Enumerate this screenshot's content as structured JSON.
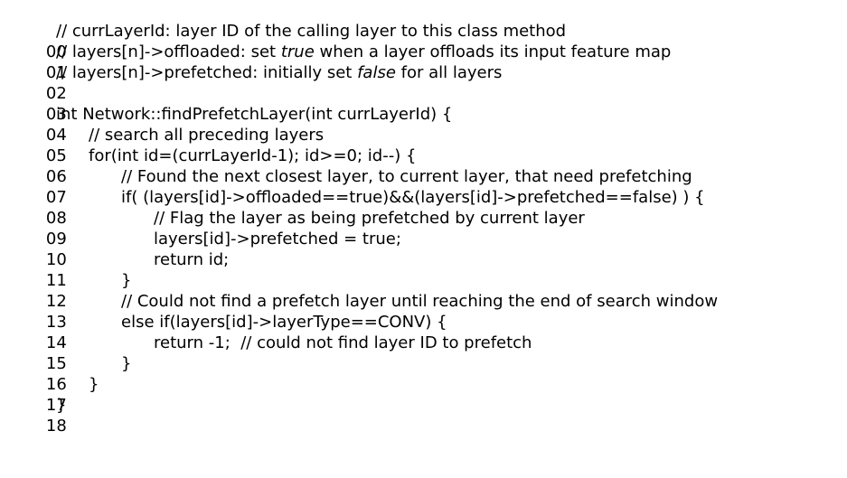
{
  "lines": [
    {
      "num": "00",
      "parts": [
        "// currLayerId: layer ID of the calling layer to this class method"
      ]
    },
    {
      "num": "01",
      "parts": [
        "// layers[n]->offloaded: set ",
        "true",
        " when a layer offloads its input feature map"
      ]
    },
    {
      "num": "02",
      "parts": [
        "// layers[n]->prefetched: initially set ",
        "false",
        " for all layers"
      ]
    },
    {
      "num": "03",
      "parts": [
        ""
      ]
    },
    {
      "num": "04",
      "parts": [
        "int Network::findPrefetchLayer(int currLayerId) {"
      ]
    },
    {
      "num": "05",
      "parts": [
        "// search all preceding layers"
      ]
    },
    {
      "num": "06",
      "parts": [
        "for(int id=(currLayerId-1); id>=0; id--) {"
      ]
    },
    {
      "num": "07",
      "parts": [
        "// Found the next closest layer, to current layer, that need prefetching"
      ]
    },
    {
      "num": "08",
      "parts": [
        "if( (layers[id]->offloaded==true)&&(layers[id]->prefetched==false) ) {"
      ]
    },
    {
      "num": "09",
      "parts": [
        "// Flag the layer as being prefetched by current layer"
      ]
    },
    {
      "num": "10",
      "parts": [
        "layers[id]->prefetched = true;"
      ]
    },
    {
      "num": "11",
      "parts": [
        "return id;"
      ]
    },
    {
      "num": "12",
      "parts": [
        "}"
      ]
    },
    {
      "num": "13",
      "parts": [
        "// Could not find a prefetch layer until reaching the end of search window"
      ]
    },
    {
      "num": "14",
      "parts": [
        "else if(layers[id]->layerType==CONV) {"
      ]
    },
    {
      "num": "15",
      "parts": [
        "return -1;  // could not find layer ID to prefetch"
      ]
    },
    {
      "num": "16",
      "parts": [
        "}"
      ]
    },
    {
      "num": "17",
      "parts": [
        "}"
      ]
    },
    {
      "num": "18",
      "parts": [
        "}"
      ]
    }
  ]
}
